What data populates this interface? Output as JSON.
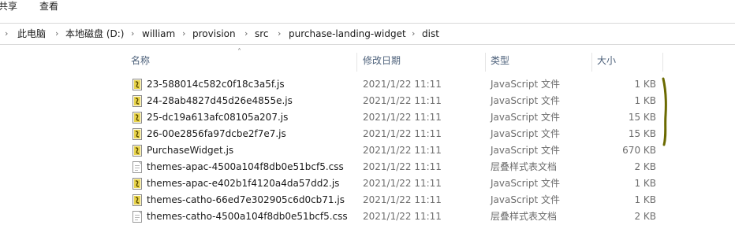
{
  "menu": {
    "items": [
      {
        "label": "共享"
      },
      {
        "label": "查看"
      }
    ]
  },
  "address": {
    "crumbs": [
      {
        "label": "此电脑"
      },
      {
        "label": "本地磁盘 (D:)"
      },
      {
        "label": "william"
      },
      {
        "label": "provision"
      },
      {
        "label": "src"
      },
      {
        "label": "purchase-landing-widget"
      },
      {
        "label": "dist"
      }
    ]
  },
  "columns": {
    "name": "名称",
    "date": "修改日期",
    "type": "类型",
    "size": "大小"
  },
  "files": [
    {
      "name": "23-588014c582c0f18c3a5f.js",
      "date": "2021/1/22 11:11",
      "type": "JavaScript 文件",
      "size": "1 KB",
      "icon": "js-file-icon"
    },
    {
      "name": "24-28ab4827d45d26e4855e.js",
      "date": "2021/1/22 11:11",
      "type": "JavaScript 文件",
      "size": "1 KB",
      "icon": "js-file-icon"
    },
    {
      "name": "25-dc19a613afc08105a207.js",
      "date": "2021/1/22 11:11",
      "type": "JavaScript 文件",
      "size": "15 KB",
      "icon": "js-file-icon"
    },
    {
      "name": "26-00e2856fa97dcbe2f7e7.js",
      "date": "2021/1/22 11:11",
      "type": "JavaScript 文件",
      "size": "15 KB",
      "icon": "js-file-icon"
    },
    {
      "name": "PurchaseWidget.js",
      "date": "2021/1/22 11:11",
      "type": "JavaScript 文件",
      "size": "670 KB",
      "icon": "js-file-icon"
    },
    {
      "name": "themes-apac-4500a104f8db0e51bcf5.css",
      "date": "2021/1/22 11:11",
      "type": "层叠样式表文档",
      "size": "2 KB",
      "icon": "css-file-icon"
    },
    {
      "name": "themes-apac-e402b1f4120a4da57dd2.js",
      "date": "2021/1/22 11:11",
      "type": "JavaScript 文件",
      "size": "1 KB",
      "icon": "js-file-icon"
    },
    {
      "name": "themes-catho-66ed7e302905c6d0cb71.js",
      "date": "2021/1/22 11:11",
      "type": "JavaScript 文件",
      "size": "1 KB",
      "icon": "js-file-icon"
    },
    {
      "name": "themes-catho-4500a104f8db0e51bcf5.css",
      "date": "2021/1/22 11:11",
      "type": "层叠样式表文档",
      "size": "2 KB",
      "icon": "css-file-icon"
    }
  ],
  "colors": {
    "annotation": "#6b6a00",
    "header_text": "#4c607a",
    "meta_text": "#6d6d6d"
  }
}
